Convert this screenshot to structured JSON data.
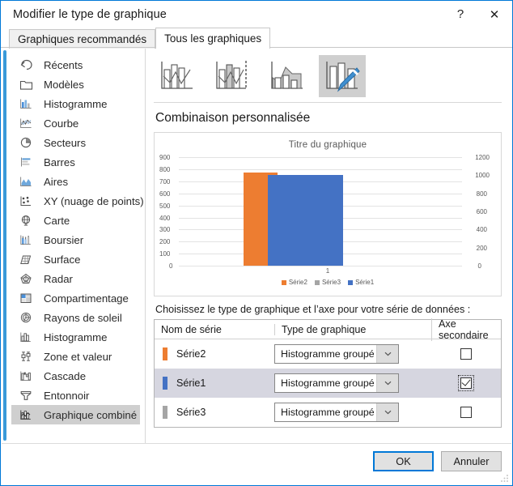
{
  "window": {
    "title": "Modifier le type de graphique",
    "help_label": "?",
    "close_label": "✕"
  },
  "tabs": [
    {
      "label": "Graphiques recommandés",
      "active": false
    },
    {
      "label": "Tous les graphiques",
      "active": true
    }
  ],
  "sidebar": {
    "items": [
      {
        "label": "Récents",
        "icon": "recent-arrow-icon",
        "selected": false
      },
      {
        "label": "Modèles",
        "icon": "folder-icon",
        "selected": false
      },
      {
        "label": "Histogramme",
        "icon": "column-chart-icon",
        "selected": false
      },
      {
        "label": "Courbe",
        "icon": "line-chart-icon",
        "selected": false
      },
      {
        "label": "Secteurs",
        "icon": "pie-chart-icon",
        "selected": false
      },
      {
        "label": "Barres",
        "icon": "bar-chart-icon",
        "selected": false
      },
      {
        "label": "Aires",
        "icon": "area-chart-icon",
        "selected": false
      },
      {
        "label": "XY (nuage de points)",
        "icon": "scatter-chart-icon",
        "selected": false
      },
      {
        "label": "Carte",
        "icon": "map-globe-icon",
        "selected": false
      },
      {
        "label": "Boursier",
        "icon": "stock-chart-icon",
        "selected": false
      },
      {
        "label": "Surface",
        "icon": "surface-chart-icon",
        "selected": false
      },
      {
        "label": "Radar",
        "icon": "radar-chart-icon",
        "selected": false
      },
      {
        "label": "Compartimentage",
        "icon": "treemap-chart-icon",
        "selected": false
      },
      {
        "label": "Rayons de soleil",
        "icon": "sunburst-chart-icon",
        "selected": false
      },
      {
        "label": "Histogramme",
        "icon": "histogram-chart-icon",
        "selected": false
      },
      {
        "label": "Zone et valeur",
        "icon": "boxwhisker-chart-icon",
        "selected": false
      },
      {
        "label": "Cascade",
        "icon": "waterfall-chart-icon",
        "selected": false
      },
      {
        "label": "Entonnoir",
        "icon": "funnel-chart-icon",
        "selected": false
      },
      {
        "label": "Graphique combiné",
        "icon": "combo-chart-icon",
        "selected": true
      }
    ]
  },
  "thumbnails": [
    {
      "name": "clustered-column-line-thumb",
      "selected": false
    },
    {
      "name": "clustered-column-line-secondary-axis-thumb",
      "selected": false
    },
    {
      "name": "stacked-area-clustered-column-thumb",
      "selected": false
    },
    {
      "name": "custom-combination-thumb",
      "selected": true
    }
  ],
  "preview": {
    "heading": "Combinaison personnalisée"
  },
  "chart_data": {
    "type": "bar",
    "title": "Titre du graphique",
    "xlabel": "",
    "ylabel": "",
    "categories": [
      "1"
    ],
    "series": [
      {
        "name": "Série2",
        "color": "#ed7d31",
        "axis": "primary",
        "values": [
          770
        ]
      },
      {
        "name": "Série3",
        "color": "#a5a5a5",
        "axis": "primary",
        "values": [
          630
        ]
      },
      {
        "name": "Série1",
        "color": "#4472c4",
        "axis": "secondary",
        "values": [
          1000
        ]
      }
    ],
    "primary_axis": {
      "ticks": [
        "900",
        "800",
        "700",
        "600",
        "500",
        "400",
        "300",
        "200",
        "100",
        "0"
      ],
      "min": 0,
      "max": 900,
      "step": 100
    },
    "secondary_axis": {
      "ticks": [
        "1200",
        "1000",
        "800",
        "600",
        "400",
        "200",
        "0"
      ],
      "min": 0,
      "max": 1200,
      "step": 200
    },
    "grid": true,
    "legend": [
      "Série2",
      "Série3",
      "Série1"
    ],
    "legend_position": "bottom"
  },
  "series_table": {
    "instruction": "Choisissez le type de graphique et l’axe pour votre série de données :",
    "headers": {
      "name": "Nom de série",
      "chart_type": "Type de graphique",
      "secondary_axis": "Axe secondaire"
    },
    "dropdown_arrow": "⌄",
    "rows": [
      {
        "series_name": "Série2",
        "color": "#ed7d31",
        "chart_type": "Histogramme groupé",
        "secondary_axis_checked": false,
        "selected": false,
        "focused": false
      },
      {
        "series_name": "Série1",
        "color": "#4472c4",
        "chart_type": "Histogramme groupé",
        "secondary_axis_checked": true,
        "selected": true,
        "focused": true
      },
      {
        "series_name": "Série3",
        "color": "#a5a5a5",
        "chart_type": "Histogramme groupé",
        "secondary_axis_checked": false,
        "selected": false,
        "focused": false
      }
    ]
  },
  "footer": {
    "ok_label": "OK",
    "cancel_label": "Annuler"
  },
  "colors": {
    "accent": "#0078d7",
    "selection": "#d6d6e0",
    "sidebar_selection": "#cfcfcf",
    "series1": "#4472c4",
    "series2": "#ed7d31",
    "series3": "#a5a5a5"
  }
}
